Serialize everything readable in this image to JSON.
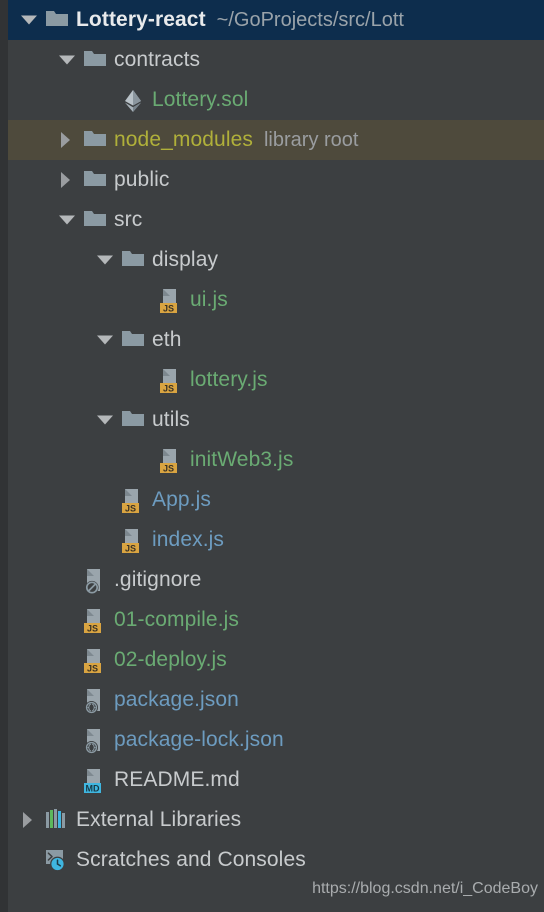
{
  "window": {
    "title": "Project",
    "background_color": "#3c3f41",
    "selected_row_color": "#0d2d4d",
    "library_root_row_color": "#4e4a3c"
  },
  "colors": {
    "text_default": "#c8cbcd",
    "text_green_untracked": "#6aab73",
    "text_blue_tracked": "#6d9cc0",
    "text_olive_excluded": "#b0b03a",
    "annotation_gray": "#9a9da0",
    "folder_icon": "#8b9aa3",
    "js_badge": "#d9a441",
    "md_badge": "#3fb6e0",
    "json_badge": "#8b9aa3"
  },
  "watermark": "https://blog.csdn.net/i_CodeBoy",
  "tree": {
    "rows": [
      {
        "name": "Lottery-react",
        "annotation": "~/GoProjects/src/Lott",
        "depth": 0,
        "arrow": "down",
        "icon": "folder-icon",
        "color": "default",
        "bold": true,
        "selected": true
      },
      {
        "name": "contracts",
        "annotation": "",
        "depth": 1,
        "arrow": "down",
        "icon": "folder-icon",
        "color": "default",
        "bold": false,
        "selected": false
      },
      {
        "name": "Lottery.sol",
        "annotation": "",
        "depth": 2,
        "arrow": "none",
        "icon": "solidity-ethereum-icon",
        "color": "green",
        "bold": false,
        "selected": false
      },
      {
        "name": "node_modules",
        "annotation": "library root",
        "depth": 1,
        "arrow": "right",
        "icon": "folder-icon",
        "color": "olive",
        "bold": false,
        "selected": false,
        "library_root": true
      },
      {
        "name": "public",
        "annotation": "",
        "depth": 1,
        "arrow": "right",
        "icon": "folder-icon",
        "color": "default",
        "bold": false,
        "selected": false
      },
      {
        "name": "src",
        "annotation": "",
        "depth": 1,
        "arrow": "down",
        "icon": "folder-icon",
        "color": "default",
        "bold": false,
        "selected": false
      },
      {
        "name": "display",
        "annotation": "",
        "depth": 2,
        "arrow": "down",
        "icon": "folder-icon",
        "color": "default",
        "bold": false,
        "selected": false
      },
      {
        "name": "ui.js",
        "annotation": "",
        "depth": 3,
        "arrow": "none",
        "icon": "js-file-icon",
        "color": "green",
        "bold": false,
        "selected": false
      },
      {
        "name": "eth",
        "annotation": "",
        "depth": 2,
        "arrow": "down",
        "icon": "folder-icon",
        "color": "default",
        "bold": false,
        "selected": false
      },
      {
        "name": "lottery.js",
        "annotation": "",
        "depth": 3,
        "arrow": "none",
        "icon": "js-file-icon",
        "color": "green",
        "bold": false,
        "selected": false
      },
      {
        "name": "utils",
        "annotation": "",
        "depth": 2,
        "arrow": "down",
        "icon": "folder-icon",
        "color": "default",
        "bold": false,
        "selected": false
      },
      {
        "name": "initWeb3.js",
        "annotation": "",
        "depth": 3,
        "arrow": "none",
        "icon": "js-file-icon",
        "color": "green",
        "bold": false,
        "selected": false
      },
      {
        "name": "App.js",
        "annotation": "",
        "depth": 2,
        "arrow": "none",
        "icon": "js-file-icon",
        "color": "blue",
        "bold": false,
        "selected": false
      },
      {
        "name": "index.js",
        "annotation": "",
        "depth": 2,
        "arrow": "none",
        "icon": "js-file-icon",
        "color": "blue",
        "bold": false,
        "selected": false
      },
      {
        "name": ".gitignore",
        "annotation": "",
        "depth": 1,
        "arrow": "none",
        "icon": "gitignore-file-icon",
        "color": "default",
        "bold": false,
        "selected": false
      },
      {
        "name": "01-compile.js",
        "annotation": "",
        "depth": 1,
        "arrow": "none",
        "icon": "js-file-icon",
        "color": "green",
        "bold": false,
        "selected": false
      },
      {
        "name": "02-deploy.js",
        "annotation": "",
        "depth": 1,
        "arrow": "none",
        "icon": "js-file-icon",
        "color": "green",
        "bold": false,
        "selected": false
      },
      {
        "name": "package.json",
        "annotation": "",
        "depth": 1,
        "arrow": "none",
        "icon": "json-file-icon",
        "color": "blue",
        "bold": false,
        "selected": false
      },
      {
        "name": "package-lock.json",
        "annotation": "",
        "depth": 1,
        "arrow": "none",
        "icon": "json-file-icon",
        "color": "blue",
        "bold": false,
        "selected": false
      },
      {
        "name": "README.md",
        "annotation": "",
        "depth": 1,
        "arrow": "none",
        "icon": "markdown-file-icon",
        "color": "default",
        "bold": false,
        "selected": false
      },
      {
        "name": "External Libraries",
        "annotation": "",
        "depth": 0,
        "arrow": "right",
        "icon": "external-libraries-icon",
        "color": "default",
        "bold": false,
        "selected": false
      },
      {
        "name": "Scratches and Consoles",
        "annotation": "",
        "depth": 0,
        "arrow": "none",
        "icon": "scratches-consoles-icon",
        "color": "default",
        "bold": false,
        "selected": false
      }
    ]
  }
}
